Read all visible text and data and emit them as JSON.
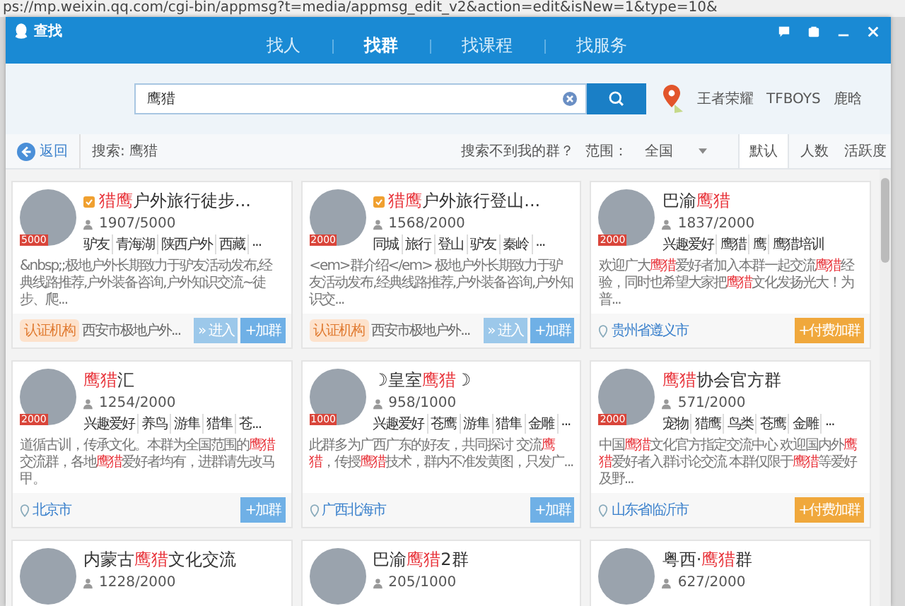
{
  "browser": {
    "url": "ps://mp.weixin.qq.com/cgi-bin/appmsg?t=media/appmsg_edit_v2&action=edit&isNew=1&type=10&"
  },
  "window": {
    "title": "查找"
  },
  "tabs": [
    {
      "label": "找人",
      "selected": false
    },
    {
      "label": "找群",
      "selected": true
    },
    {
      "label": "找课程",
      "selected": false
    },
    {
      "label": "找服务",
      "selected": false
    }
  ],
  "search": {
    "value": "鹰猎",
    "hot_words": [
      "王者荣耀",
      "TFBOYS",
      "鹿晗"
    ]
  },
  "filter_bar": {
    "back": "返回",
    "query_label": "搜索: 鹰猎",
    "help": "搜索不到我的群？",
    "range_label": "范围：",
    "range_value": "全国",
    "sort": [
      {
        "label": "默认",
        "selected": true
      },
      {
        "label": "人数",
        "selected": false
      },
      {
        "label": "活跃度",
        "selected": false
      }
    ]
  },
  "groups": [
    {
      "name": [
        {
          "text": "猎鹰",
          "highlight": true
        },
        {
          "text": "户外旅行徒步...",
          "highlight": false
        }
      ],
      "verified": true,
      "level_badge": "5000",
      "members": "1907/5000",
      "tags": [
        "驴友",
        "青海湖",
        "陕西户外",
        "西藏",
        "..."
      ],
      "description": [
        {
          "text": "&nbsp;;极地户外长期致力于驴友活动发布,经典线路推荐,户外装备咨询,户外知识交流~徒步、爬...",
          "highlight": false
        }
      ],
      "certified": "认证机构",
      "location": "西安市极地户外...",
      "enter": "» 进入",
      "join": {
        "label": "+加群",
        "kind": "free"
      }
    },
    {
      "name": [
        {
          "text": "猎鹰",
          "highlight": true
        },
        {
          "text": "户外旅行登山...",
          "highlight": false
        }
      ],
      "verified": true,
      "level_badge": "2000",
      "members": "1568/2000",
      "tags": [
        "同城",
        "旅行",
        "登山",
        "驴友",
        "秦岭",
        "..."
      ],
      "description": [
        {
          "text": "<em>群介绍</em> 极地户外长期致力于驴友活动发布,经典线路推荐,户外装备咨询,户外知识交...",
          "highlight": false
        }
      ],
      "certified": "认证机构",
      "location": "西安市极地户外...",
      "enter": "» 进入",
      "join": {
        "label": "+加群",
        "kind": "free"
      }
    },
    {
      "name": [
        {
          "text": "巴渝",
          "highlight": false
        },
        {
          "text": "鹰猎",
          "highlight": true
        }
      ],
      "verified": false,
      "level_badge": "2000",
      "members": "1837/2000",
      "tags": [
        "兴趣爱好",
        "鹰猎",
        "鹰",
        "鹰猎培训"
      ],
      "description": [
        {
          "text": "欢迎广大",
          "highlight": false
        },
        {
          "text": "鹰猎",
          "highlight": true
        },
        {
          "text": "爱好者加入本群一起交流",
          "highlight": false
        },
        {
          "text": "鹰猎",
          "highlight": true
        },
        {
          "text": "经验，同时也希望大家把",
          "highlight": false
        },
        {
          "text": "鹰猎",
          "highlight": true
        },
        {
          "text": "文化发扬光大！为普...",
          "highlight": false
        }
      ],
      "location": "贵州省遵义市",
      "join": {
        "label": "+付费加群",
        "kind": "paid"
      }
    },
    {
      "name": [
        {
          "text": "鹰猎",
          "highlight": true
        },
        {
          "text": "汇",
          "highlight": false
        }
      ],
      "verified": false,
      "level_badge": "2000",
      "members": "1254/2000",
      "tags": [
        "兴趣爱好",
        "养鸟",
        "游隼",
        "猎隼",
        "苍..."
      ],
      "description": [
        {
          "text": "道循古训，传承文化。本群为全国范围的",
          "highlight": false
        },
        {
          "text": "鹰猎",
          "highlight": true
        },
        {
          "text": "交流群，各地",
          "highlight": false
        },
        {
          "text": "鹰猎",
          "highlight": true
        },
        {
          "text": "爱好者均有，进群请先改马甲。",
          "highlight": false
        }
      ],
      "location": "北京市",
      "join": {
        "label": "+加群",
        "kind": "free"
      }
    },
    {
      "name": [
        {
          "text": "☽皇室",
          "highlight": false
        },
        {
          "text": "鹰猎",
          "highlight": true
        },
        {
          "text": "☽",
          "highlight": false
        }
      ],
      "verified": false,
      "level_badge": "1000",
      "members": "958/1000",
      "tags": [
        "兴趣爱好",
        "苍鹰",
        "游隼",
        "猎隼",
        "金雕",
        "..."
      ],
      "description": [
        {
          "text": "此群多为广西广东的好友，共同探讨 交流",
          "highlight": false
        },
        {
          "text": "鹰猎",
          "highlight": true
        },
        {
          "text": "，传授",
          "highlight": false
        },
        {
          "text": "鹰猎",
          "highlight": true
        },
        {
          "text": "技术，群内不准发黄图，只发广...",
          "highlight": false
        }
      ],
      "location": "广西北海市",
      "join": {
        "label": "+加群",
        "kind": "free"
      }
    },
    {
      "name": [
        {
          "text": "鹰猎",
          "highlight": true
        },
        {
          "text": "协会官方群",
          "highlight": false
        }
      ],
      "verified": false,
      "level_badge": "2000",
      "members": "571/2000",
      "tags": [
        "宠物",
        "猎鹰",
        "鸟类",
        "苍鹰",
        "金雕",
        "..."
      ],
      "description": [
        {
          "text": "中国",
          "highlight": false
        },
        {
          "text": "鹰猎",
          "highlight": true
        },
        {
          "text": "文化官方指定交流中心 欢迎国内外",
          "highlight": false
        },
        {
          "text": "鹰猎",
          "highlight": true
        },
        {
          "text": "爱好者入群讨论交流 本群仅限于",
          "highlight": false
        },
        {
          "text": "鹰猎",
          "highlight": true
        },
        {
          "text": "等爱好及野...",
          "highlight": false
        }
      ],
      "location": "山东省临沂市",
      "join": {
        "label": "+付费加群",
        "kind": "paid"
      }
    },
    {
      "name": [
        {
          "text": "内蒙古",
          "highlight": false
        },
        {
          "text": "鹰猎",
          "highlight": true
        },
        {
          "text": "文化交流",
          "highlight": false
        }
      ],
      "verified": false,
      "members": "1228/2000"
    },
    {
      "name": [
        {
          "text": "巴渝",
          "highlight": false
        },
        {
          "text": "鹰猎",
          "highlight": true
        },
        {
          "text": "2群",
          "highlight": false
        }
      ],
      "verified": false,
      "members": "205/1000"
    },
    {
      "name": [
        {
          "text": "粤西·",
          "highlight": false
        },
        {
          "text": "鹰猎",
          "highlight": true
        },
        {
          "text": "群",
          "highlight": false
        }
      ],
      "verified": false,
      "members": "627/2000"
    }
  ]
}
